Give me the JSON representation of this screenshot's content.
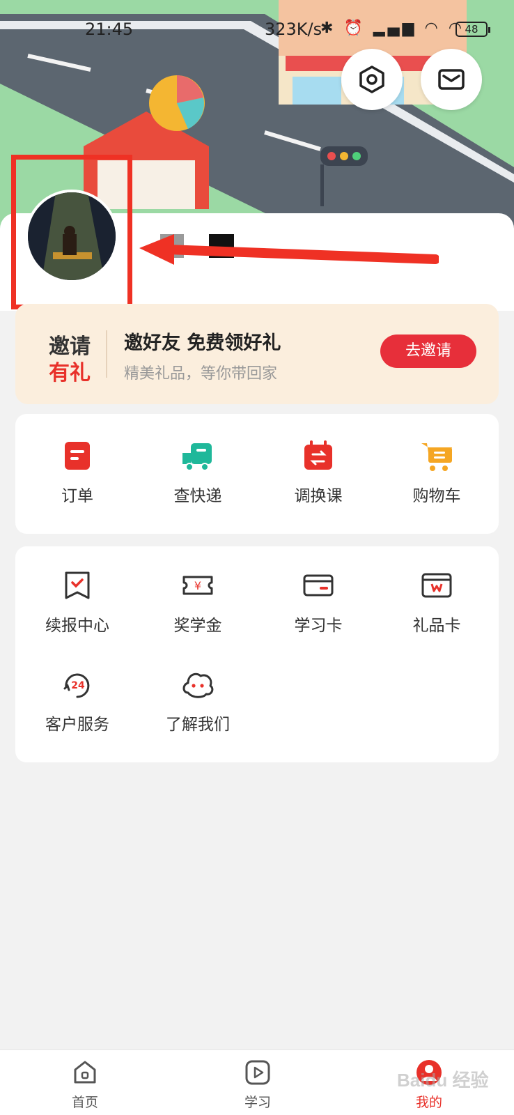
{
  "status_bar": {
    "time": "21:45",
    "network_speed": "323K/s",
    "battery": "48"
  },
  "header": {
    "settings_icon": "hexagon-settings-icon",
    "message_icon": "envelope-icon"
  },
  "invite": {
    "badge_top": "邀请",
    "badge_bottom": "有礼",
    "title": "邀好友 免费领好礼",
    "subtitle": "精美礼品，等你带回家",
    "button": "去邀请"
  },
  "quick_actions": [
    {
      "label": "订单",
      "icon": "order-icon"
    },
    {
      "label": "查快递",
      "icon": "delivery-truck-icon"
    },
    {
      "label": "调换课",
      "icon": "swap-course-icon"
    },
    {
      "label": "购物车",
      "icon": "shopping-cart-icon"
    }
  ],
  "services": [
    {
      "label": "续报中心",
      "icon": "renewal-icon"
    },
    {
      "label": "奖学金",
      "icon": "scholarship-icon"
    },
    {
      "label": "学习卡",
      "icon": "study-card-icon"
    },
    {
      "label": "礼品卡",
      "icon": "gift-card-icon"
    },
    {
      "label": "客户服务",
      "icon": "customer-service-24-icon"
    },
    {
      "label": "了解我们",
      "icon": "about-us-icon"
    }
  ],
  "tabbar": [
    {
      "label": "首页",
      "icon": "home-icon"
    },
    {
      "label": "学习",
      "icon": "play-icon"
    },
    {
      "label": "我的",
      "icon": "profile-icon"
    }
  ],
  "watermark": "Baidu 经验",
  "colors": {
    "accent": "#e8312a",
    "teal": "#1fb89a",
    "orange": "#f5a623"
  }
}
